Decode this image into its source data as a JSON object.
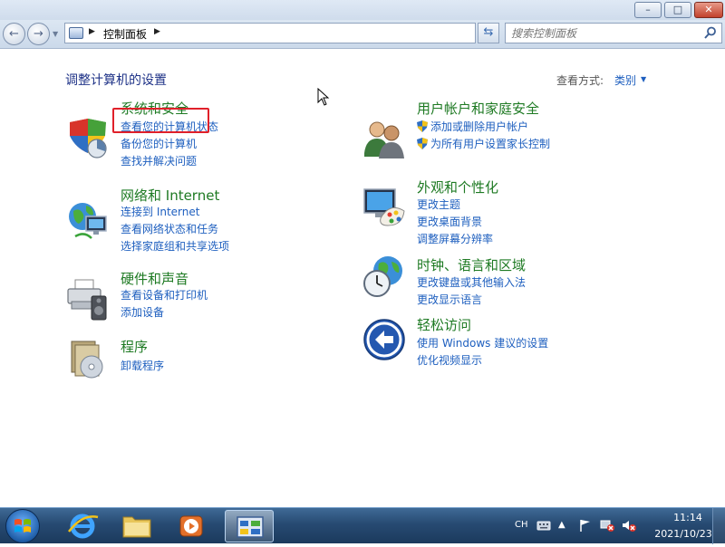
{
  "window": {
    "minimize_glyph": "–",
    "maximize_glyph": "□",
    "close_glyph": "✕"
  },
  "address": {
    "back_glyph": "←",
    "forward_glyph": "→",
    "path": "控制面板",
    "refresh_glyph": "⇆",
    "search_placeholder": "搜索控制面板"
  },
  "header": {
    "title": "调整计算机的设置",
    "view_label": "查看方式:",
    "view_value": "类别"
  },
  "categories": [
    {
      "title": "系统和安全",
      "links": [
        "查看您的计算机状态",
        "备份您的计算机",
        "查找并解决问题"
      ],
      "icon": "shield-chart-icon"
    },
    {
      "title": "网络和 Internet",
      "links": [
        "连接到 Internet",
        "查看网络状态和任务",
        "选择家庭组和共享选项"
      ],
      "icon": "network-globe-icon"
    },
    {
      "title": "硬件和声音",
      "links": [
        "查看设备和打印机",
        "添加设备"
      ],
      "icon": "printer-speaker-icon"
    },
    {
      "title": "程序",
      "links": [
        "卸载程序"
      ],
      "icon": "programs-disc-icon"
    },
    {
      "title": "用户帐户和家庭安全",
      "links": [
        "添加或删除用户帐户",
        "为所有用户设置家长控制"
      ],
      "icon": "users-icon"
    },
    {
      "title": "外观和个性化",
      "links": [
        "更改主题",
        "更改桌面背景",
        "调整屏幕分辨率"
      ],
      "icon": "monitor-palette-icon"
    },
    {
      "title": "时钟、语言和区域",
      "links": [
        "更改键盘或其他输入法",
        "更改显示语言"
      ],
      "icon": "clock-globe-icon"
    },
    {
      "title": "轻松访问",
      "links": [
        "使用 Windows 建议的设置",
        "优化视频显示"
      ],
      "icon": "ease-of-access-icon"
    }
  ],
  "taskbar": {
    "language": "CH",
    "time": "11:14",
    "date": "2021/10/23"
  },
  "colors": {
    "category_title": "#1e7a23",
    "link": "#1e5fbf",
    "page_title": "#1e3287",
    "highlight": "#e0202a",
    "taskbar": "#274a72"
  }
}
